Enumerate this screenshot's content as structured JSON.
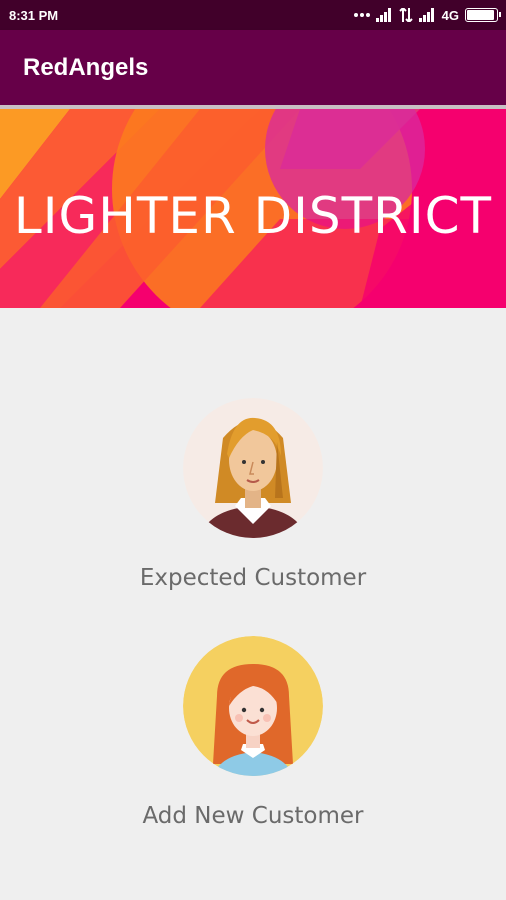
{
  "status_bar": {
    "time": "8:31 PM",
    "network": "4G",
    "icons": [
      "dots-icon",
      "signal-icon",
      "data-transfer-icon",
      "signal-icon",
      "battery-icon"
    ],
    "battery_level": 0.95
  },
  "app_bar": {
    "title": "RedAngels"
  },
  "banner": {
    "title": "LIGHTER DISTRICT",
    "colors": {
      "pink": "#f5006e",
      "orange": "#fc7a1e",
      "magenta": "#d82aa0"
    }
  },
  "options": {
    "expected": {
      "label": "Expected Customer",
      "icon": "woman-avatar-icon"
    },
    "add_new": {
      "label": "Add New Customer",
      "icon": "girl-avatar-icon"
    }
  },
  "colors": {
    "status_bar": "#41002a",
    "app_bar": "#660048",
    "background": "#efefef",
    "label_text": "#6a6a6a"
  }
}
